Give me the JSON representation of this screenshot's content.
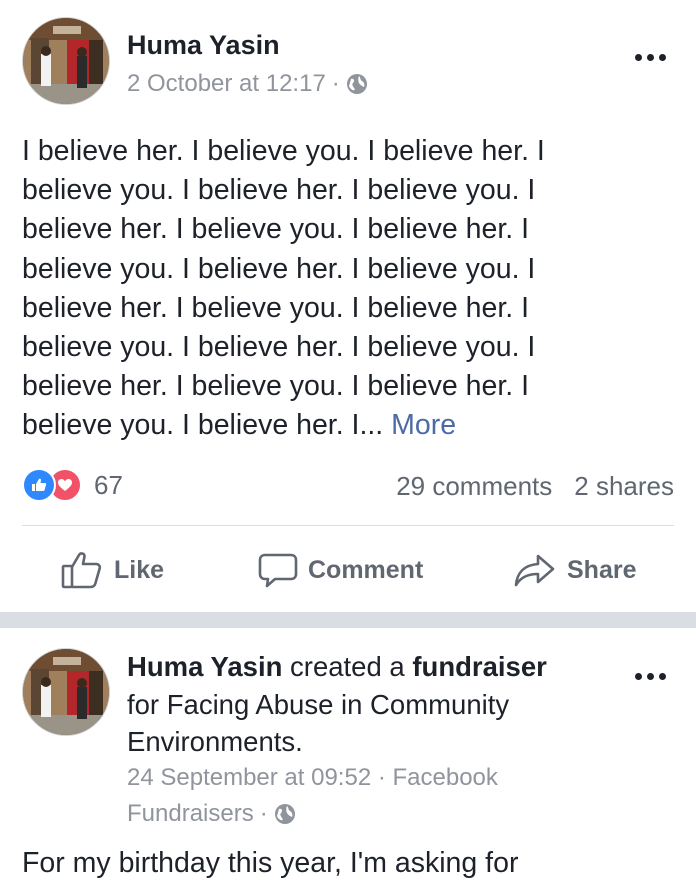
{
  "post1": {
    "author": "Huma Yasin",
    "timestamp": "2 October at 12:17",
    "meta_separator": "·",
    "privacy_icon": "globe-icon",
    "text_lines": [
      "I believe her. I believe you. I believe her. I",
      "believe you. I believe her. I believe you. I",
      "believe her. I believe you. I believe her. I",
      "believe you. I believe her. I believe you. I",
      "believe her. I believe you. I believe her. I",
      "believe you. I believe her. I believe you. I",
      "believe her. I believe you. I believe her. I",
      "believe you. I believe her. I..."
    ],
    "more_label": "More",
    "reaction_count": "67",
    "comments": "29 comments",
    "shares": "2 shares",
    "actions": {
      "like": "Like",
      "comment": "Comment",
      "share": "Share"
    }
  },
  "post2": {
    "author": "Huma Yasin",
    "verb": "created a",
    "object": "fundraiser",
    "line2": "for Facing Abuse in Community",
    "line3": "Environments.",
    "timestamp_line": "24 September at 09:52 · Facebook",
    "source_line": "Fundraisers",
    "meta_separator": "·",
    "privacy_icon": "globe-icon",
    "body": "For my birthday this year, I'm asking for"
  },
  "colors": {
    "text": "#1d2129",
    "muted": "#90949c",
    "link": "#4b6aa6",
    "like_blue": "#2e89ff",
    "love_red": "#f25268",
    "separator": "#dadde1"
  }
}
